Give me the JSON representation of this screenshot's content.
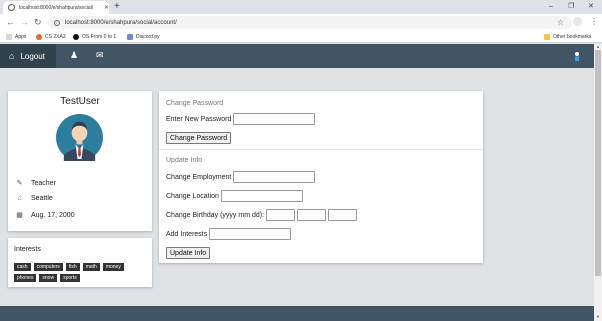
{
  "browser": {
    "tab_title": "localhost:8000/e/shahpura/social/",
    "url": "localhost:8000/e/shahpura/social/account/",
    "bookmarks": [
      "Apps",
      "CS 2XA3",
      "OS From 0 to 1",
      "Discord.py"
    ],
    "other_bookmarks": "Other bookmarks"
  },
  "navbar": {
    "logout_label": "Logout"
  },
  "profile": {
    "username": "TestUser",
    "employment": "Teacher",
    "location": "Seattle",
    "birthday": "Aug. 17, 2000"
  },
  "interests": {
    "title": "Interests",
    "tags": [
      "cash",
      "computers",
      "fish",
      "math",
      "money",
      "phones",
      "snow",
      "sports"
    ]
  },
  "password_section": {
    "title": "Change Password",
    "new_password_label": "Enter New Password",
    "button_label": "Change Password"
  },
  "info_section": {
    "title": "Update Info",
    "employment_label": "Change Employment",
    "location_label": "Change Location",
    "birthday_label": "Change Birthday (yyyy mm dd):",
    "interests_label": "Add Interests",
    "button_label": "Update Info"
  },
  "colors": {
    "navbar": "#415565",
    "navbar_active": "#31424f",
    "tag": "#333333"
  }
}
